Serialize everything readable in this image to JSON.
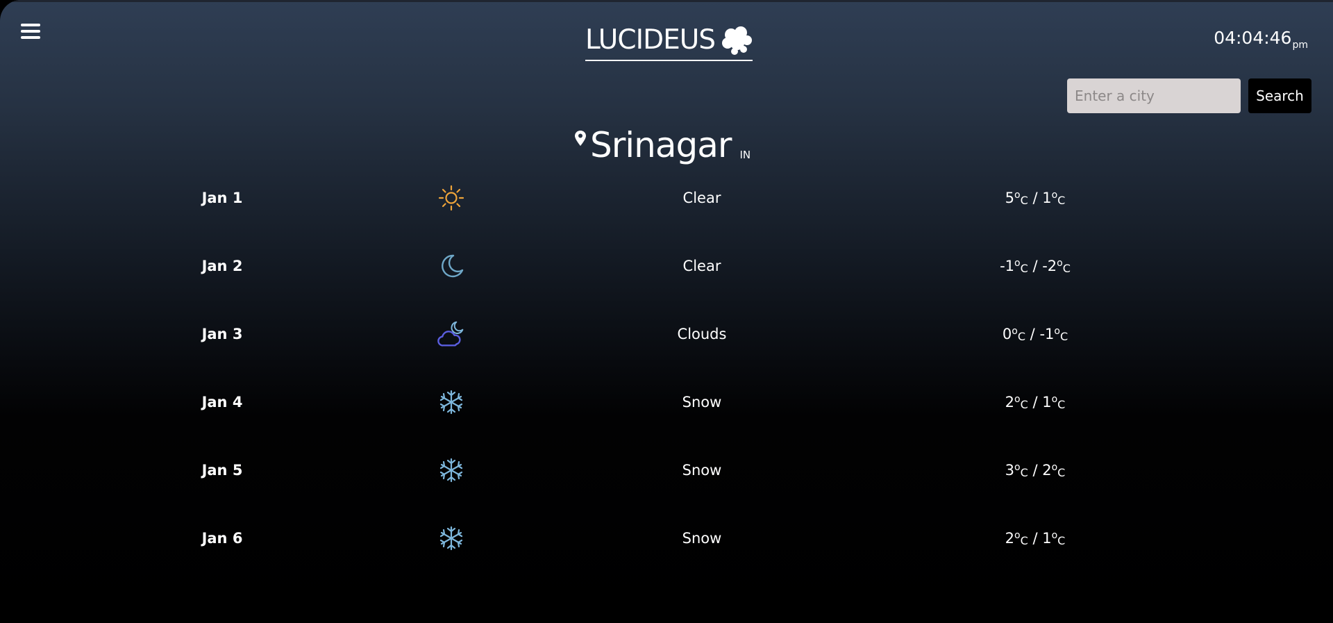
{
  "header": {
    "brand": "LUCIDEUS",
    "brand_icon": "cloud-icon",
    "menu_icon": "hamburger-menu-icon",
    "clock_time": "04:04:46",
    "clock_period": "pm"
  },
  "search": {
    "placeholder": "Enter a city",
    "value": "",
    "button_label": "Search"
  },
  "location": {
    "city": "Srinagar",
    "country": "IN",
    "icon": "map-pin-icon"
  },
  "forecast": [
    {
      "date": "Jan 1",
      "icon": "sun-icon",
      "condition": "Clear",
      "high": "5",
      "low": "1"
    },
    {
      "date": "Jan 2",
      "icon": "moon-icon",
      "condition": "Clear",
      "high": "-1",
      "low": "-2"
    },
    {
      "date": "Jan 3",
      "icon": "cloud-moon-icon",
      "condition": "Clouds",
      "high": "0",
      "low": "-1"
    },
    {
      "date": "Jan 4",
      "icon": "snowflake-icon",
      "condition": "Snow",
      "high": "2",
      "low": "1"
    },
    {
      "date": "Jan 5",
      "icon": "snowflake-icon",
      "condition": "Snow",
      "high": "3",
      "low": "2"
    },
    {
      "date": "Jan 6",
      "icon": "snowflake-icon",
      "condition": "Snow",
      "high": "2",
      "low": "1"
    }
  ],
  "units": {
    "degree": "o",
    "scale": "C",
    "separator": "/"
  },
  "colors": {
    "sun": "#f0a53a",
    "moon": "#6fa8c8",
    "cloud": "#5b5ee0",
    "snow": "#7eb7dc",
    "search_bg": "#d9d4d4",
    "button_bg": "#000000"
  }
}
